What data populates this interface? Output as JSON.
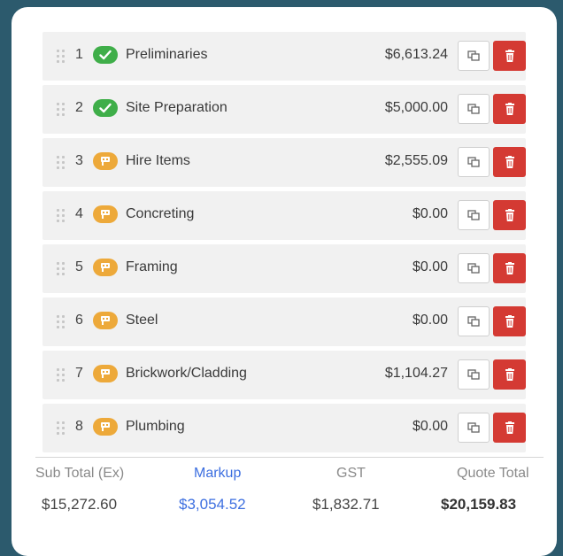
{
  "items": [
    {
      "number": "1",
      "name": "Preliminaries",
      "amount": "$6,613.24",
      "status": "complete",
      "status_icon": "check-icon"
    },
    {
      "number": "2",
      "name": "Site Preparation",
      "amount": "$5,000.00",
      "status": "complete",
      "status_icon": "check-icon"
    },
    {
      "number": "3",
      "name": "Hire Items",
      "amount": "$2,555.09",
      "status": "pending",
      "status_icon": "flag-icon"
    },
    {
      "number": "4",
      "name": "Concreting",
      "amount": "$0.00",
      "status": "pending",
      "status_icon": "flag-icon"
    },
    {
      "number": "5",
      "name": "Framing",
      "amount": "$0.00",
      "status": "pending",
      "status_icon": "flag-icon"
    },
    {
      "number": "6",
      "name": "Steel",
      "amount": "$0.00",
      "status": "pending",
      "status_icon": "flag-icon"
    },
    {
      "number": "7",
      "name": "Brickwork/Cladding",
      "amount": "$1,104.27",
      "status": "pending",
      "status_icon": "flag-icon"
    },
    {
      "number": "8",
      "name": "Plumbing",
      "amount": "$0.00",
      "status": "pending",
      "status_icon": "flag-icon"
    }
  ],
  "totals": {
    "subtotal_label": "Sub Total (Ex)",
    "subtotal_value": "$15,272.60",
    "markup_label": "Markup",
    "markup_value": "$3,054.52",
    "gst_label": "GST",
    "gst_value": "$1,832.71",
    "quote_total_label": "Quote Total",
    "quote_total_value": "$20,159.83"
  },
  "colors": {
    "background": "#2c5a6d",
    "complete": "#3fae49",
    "pending": "#eda93a",
    "delete": "#d43a33",
    "markup": "#3d6fe0"
  }
}
